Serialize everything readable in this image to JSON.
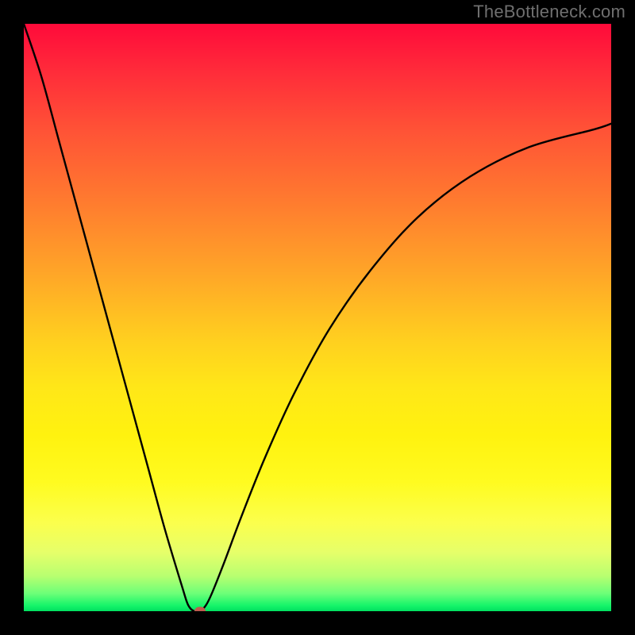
{
  "watermark": "TheBottleneck.com",
  "chart_data": {
    "type": "line",
    "title": "",
    "xlabel": "",
    "ylabel": "",
    "xlim": [
      0,
      100
    ],
    "ylim": [
      0,
      100
    ],
    "grid": false,
    "legend": false,
    "background": {
      "type": "vertical-gradient",
      "stops": [
        {
          "pos": 0,
          "color": "#ff0a3a"
        },
        {
          "pos": 30,
          "color": "#ff7a2f"
        },
        {
          "pos": 55,
          "color": "#ffd01f"
        },
        {
          "pos": 80,
          "color": "#fbff4d"
        },
        {
          "pos": 97,
          "color": "#6cff78"
        },
        {
          "pos": 100,
          "color": "#00e060"
        }
      ]
    },
    "series": [
      {
        "name": "bottleneck-curve",
        "color": "#000000",
        "x": [
          0,
          3,
          6,
          9,
          12,
          15,
          18,
          21,
          24,
          27,
          28,
          29,
          30,
          31,
          32,
          34,
          37,
          41,
          46,
          52,
          59,
          67,
          76,
          86,
          97,
          100
        ],
        "y": [
          100,
          91,
          80,
          69,
          58,
          47,
          36,
          25,
          14,
          4,
          1,
          0,
          0,
          1,
          3,
          8,
          16,
          26,
          37,
          48,
          58,
          67,
          74,
          79,
          82,
          83
        ]
      }
    ],
    "marker": {
      "x": 30,
      "y": 0,
      "color": "#c05a4e"
    }
  }
}
